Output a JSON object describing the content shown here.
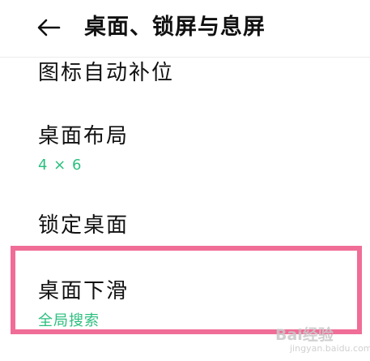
{
  "header": {
    "back_icon": "arrow-left-icon",
    "title": "桌面、锁屏与息屏"
  },
  "settings": {
    "auto_fill_icons": {
      "label": "图标自动补位"
    },
    "desktop_layout": {
      "label": "桌面布局",
      "value": "4 × 6"
    },
    "lock_desktop": {
      "label": "锁定桌面"
    },
    "desktop_swipe_down": {
      "label": "桌面下滑",
      "value": "全局搜索"
    }
  },
  "colors": {
    "accent_green": "#2bbf7e",
    "highlight_pink": "#f06d97"
  },
  "watermark": {
    "logo": "Bai经验",
    "sub": "jingyan.baidu.com"
  }
}
